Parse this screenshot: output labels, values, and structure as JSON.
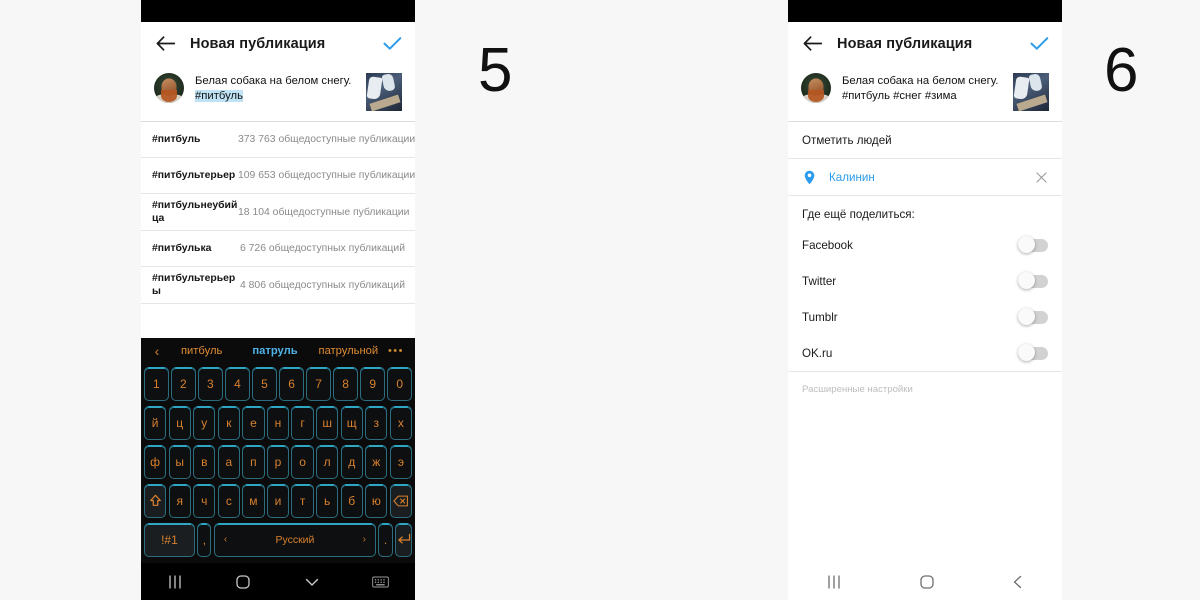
{
  "steps": {
    "left": "5",
    "right": "6"
  },
  "left_panel": {
    "appbar": {
      "back_icon": "arrow-left-icon",
      "title": "Новая публикация",
      "confirm_icon": "check-icon"
    },
    "post": {
      "caption_line1": "Белая собака на белом снегу.",
      "caption_hashtag": "#питбуль",
      "avatar": "user-avatar",
      "thumbnail": "post-thumbnail"
    },
    "hashtag_suggestions": [
      {
        "tag": "#питбуль",
        "count": "373 763 общедоступные публикации"
      },
      {
        "tag": "#питбультерьер",
        "count": "109 653 общедоступные публикации"
      },
      {
        "tag": "#питбульнеубийца",
        "count": "18 104 общедоступные публикации"
      },
      {
        "tag": "#питбулька",
        "count": "6 726 общедоступных публикаций"
      },
      {
        "tag": "#питбультерьеры",
        "count": "4 806 общедоступных публикаций"
      }
    ],
    "keyboard": {
      "suggestions": [
        {
          "word": "питбуль",
          "state": "normal"
        },
        {
          "word": "патруль",
          "state": "selected"
        },
        {
          "word": "патрульной",
          "state": "normal"
        }
      ],
      "prev_icon": "chevron-left-icon",
      "more_icon": "more-options-icon",
      "row_numbers": [
        "1",
        "2",
        "3",
        "4",
        "5",
        "6",
        "7",
        "8",
        "9",
        "0"
      ],
      "row_top": [
        "й",
        "ц",
        "у",
        "к",
        "е",
        "н",
        "г",
        "ш",
        "щ",
        "з",
        "х"
      ],
      "row_middle": [
        "ф",
        "ы",
        "в",
        "а",
        "п",
        "р",
        "о",
        "л",
        "д",
        "ж",
        "э"
      ],
      "row_bottom": [
        "я",
        "ч",
        "с",
        "м",
        "и",
        "т",
        "ь",
        "б",
        "ю"
      ],
      "shift_icon": "shift-icon",
      "backspace_icon": "backspace-icon",
      "symbols_key": "!#1",
      "comma_key": ",",
      "space_key": "Русский",
      "space_prev": "‹",
      "space_next": "›",
      "period_key": ".",
      "enter_icon": "enter-icon"
    },
    "navbar": {
      "recents_icon": "recents-icon",
      "home_icon": "home-icon",
      "hide_keyboard_icon": "chevron-down-icon",
      "keyboard_switch_icon": "keyboard-icon"
    }
  },
  "right_panel": {
    "appbar": {
      "back_icon": "arrow-left-icon",
      "title": "Новая публикация",
      "confirm_icon": "check-icon"
    },
    "post": {
      "caption_line1": "Белая собака на белом снегу.",
      "caption_line2": "#питбуль #снег #зима",
      "avatar": "user-avatar",
      "thumbnail": "post-thumbnail"
    },
    "tag_people_label": "Отметить людей",
    "location": {
      "pin_icon": "location-pin-icon",
      "name": "Калинин",
      "clear_icon": "close-icon"
    },
    "share_heading": "Где ещё поделиться:",
    "share_targets": [
      {
        "label": "Facebook",
        "enabled": false
      },
      {
        "label": "Twitter",
        "enabled": false
      },
      {
        "label": "Tumblr",
        "enabled": false
      },
      {
        "label": "OK.ru",
        "enabled": false
      }
    ],
    "advanced_settings": "Расширенные настройки",
    "navbar": {
      "recents_icon": "recents-icon",
      "home_icon": "home-icon",
      "back_icon": "chevron-left-icon"
    }
  },
  "colors": {
    "accent_blue": "#2d9cec",
    "keyboard_key_text": "#d9812e",
    "keyboard_border": "#2c6e80",
    "suggestion_selected": "#4fb3e8",
    "page_bg": "#f7f7f7",
    "highlight": "#bfe2f5"
  }
}
